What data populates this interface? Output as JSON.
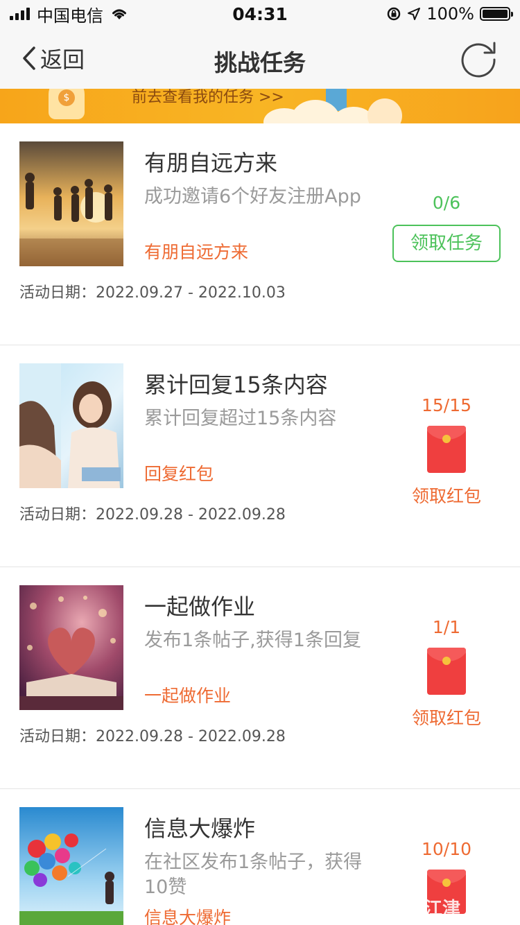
{
  "status_bar": {
    "carrier": "中国电信",
    "time": "04:31",
    "battery": "100%",
    "icons": [
      "signal-icon",
      "wifi-icon",
      "rotation-lock-icon",
      "location-icon",
      "battery-icon"
    ]
  },
  "nav": {
    "back_label": "返回",
    "title": "挑战任务",
    "refresh_icon": "refresh-icon"
  },
  "banner": {
    "text": "前去查看我的任务 >>"
  },
  "colors": {
    "accent_orange": "#ee6a32",
    "accept_green": "#4cc25a",
    "redpack_red": "#ef3f3f"
  },
  "tasks": [
    {
      "title": "有朋自远方来",
      "desc": "成功邀请6个好友注册App",
      "tag": "有朋自远方来",
      "date_label": "活动日期：",
      "date_range": "2022.09.27 - 2022.10.03",
      "progress": "0/6",
      "action": "领取任务",
      "action_type": "accept-task"
    },
    {
      "title": "累计回复15条内容",
      "desc": "累计回复超过15条内容",
      "tag": "回复红包",
      "date_label": "活动日期：",
      "date_range": "2022.09.28 - 2022.09.28",
      "progress": "15/15",
      "action": "领取红包",
      "action_type": "claim-red-packet"
    },
    {
      "title": "一起做作业",
      "desc": "发布1条帖子,获得1条回复",
      "tag": "一起做作业",
      "date_label": "活动日期：",
      "date_range": "2022.09.28 - 2022.09.28",
      "progress": "1/1",
      "action": "领取红包",
      "action_type": "claim-red-packet"
    },
    {
      "title": "信息大爆炸",
      "desc": "在社区发布1条帖子，获得10赞",
      "tag": "信息大爆炸",
      "progress": "10/10",
      "action_type": "claim-red-packet"
    }
  ],
  "watermark": "江津"
}
